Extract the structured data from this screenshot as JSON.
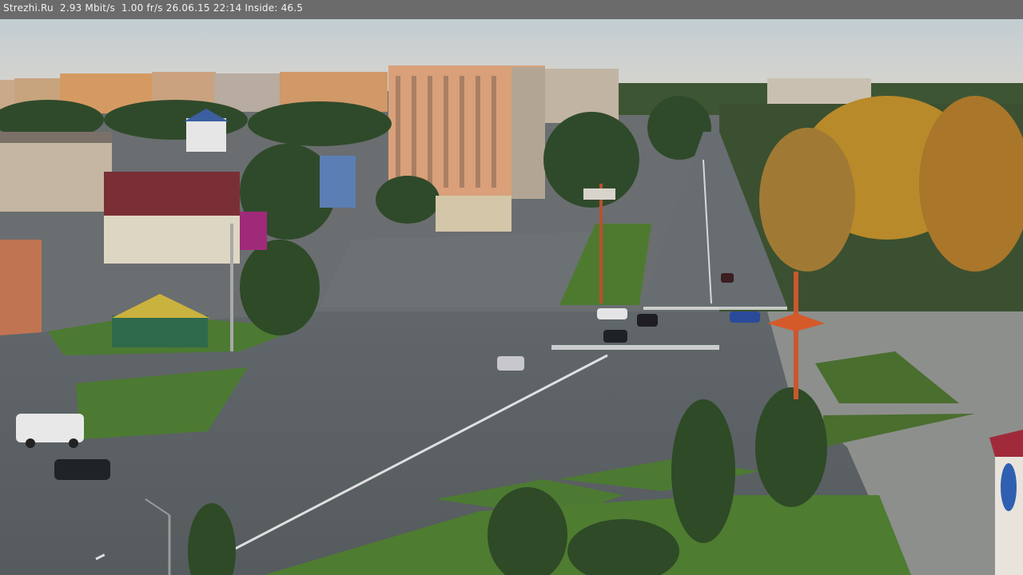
{
  "camera_overlay": {
    "site": "Strezhi.Ru",
    "bitrate": "2.93 Mbit/s",
    "framerate": "1.00 fr/s",
    "datetime": "26.06.15 22:14",
    "inside_temp": "Inside: 46.5",
    "full_text": "Strezhi.Ru  2.93 Mbit/s  1.00 fr/s 26.06.15 22:14 Inside: 46.5"
  },
  "scene": {
    "description_tags": [
      "city-intersection",
      "webcam",
      "evening"
    ],
    "colors": {
      "sky": "#c9d0d2",
      "asphalt": "#5c6266",
      "grass": "#4c7a32",
      "trees_dark": "#2f4a2a",
      "trees_autumn": "#b98a2a",
      "building_lit": "#d89a6a",
      "overlay_bar": "#6b6b6b"
    }
  }
}
